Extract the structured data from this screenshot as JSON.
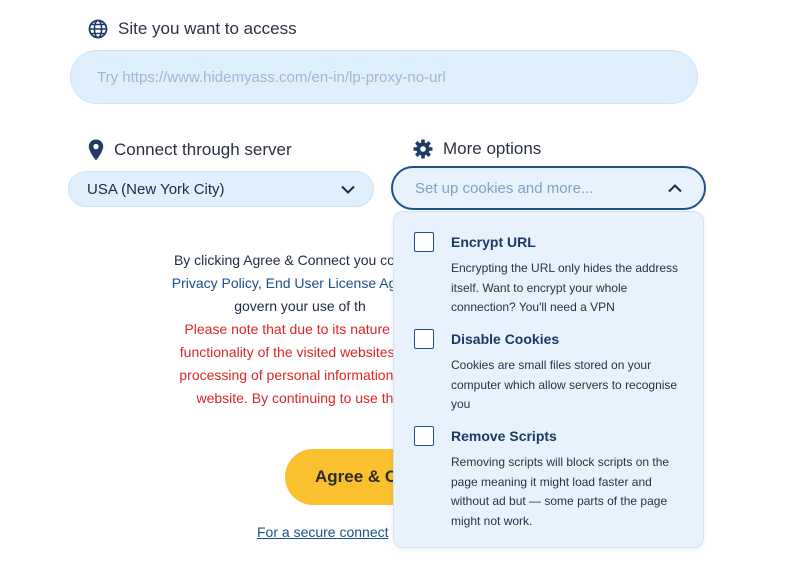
{
  "site": {
    "label": "Site you want to access",
    "placeholder": "Try https://www.hidemyass.com/en-in/lp-proxy-no-url",
    "icon": "globe-icon"
  },
  "server": {
    "label": "Connect through server",
    "value": "USA (New York City)",
    "icon": "location-pin-icon"
  },
  "options": {
    "label": "More options",
    "value": "Set up cookies and more...",
    "icon": "gear-icon",
    "items": [
      {
        "title": "Encrypt URL",
        "description": "Encrypting the URL only hides the address itself. Want to encrypt your whole connection? You'll need a VPN",
        "checked": false
      },
      {
        "title": "Disable Cookies",
        "description": "Cookies are small files stored on your computer which allow servers to recognise you",
        "checked": false
      },
      {
        "title": "Remove Scripts",
        "description": "Removing scripts will block scripts on the page meaning it might load faster and without ad but — some parts of the page might not work.",
        "checked": false
      }
    ]
  },
  "legal": {
    "line1_prefix": "By clicking ",
    "line1_bold": "Agree & Connect",
    "line1_suffix": " you confirm",
    "privacy_link": "Privacy Policy",
    "eula_link": "End User License Agreem",
    "line3": "govern your use of th",
    "warning_lines": [
      "Please note that due to its nature this",
      "functionality of the visited websites, inc",
      "processing of personal information that",
      "website. By continuing to use this"
    ]
  },
  "agree_button": "Agree & C",
  "secure_link": "For a secure connect",
  "colors": {
    "accent": "#1f4f8c",
    "field_bg": "#e0effc",
    "warning": "#dc2626",
    "button": "#fbc02d"
  }
}
